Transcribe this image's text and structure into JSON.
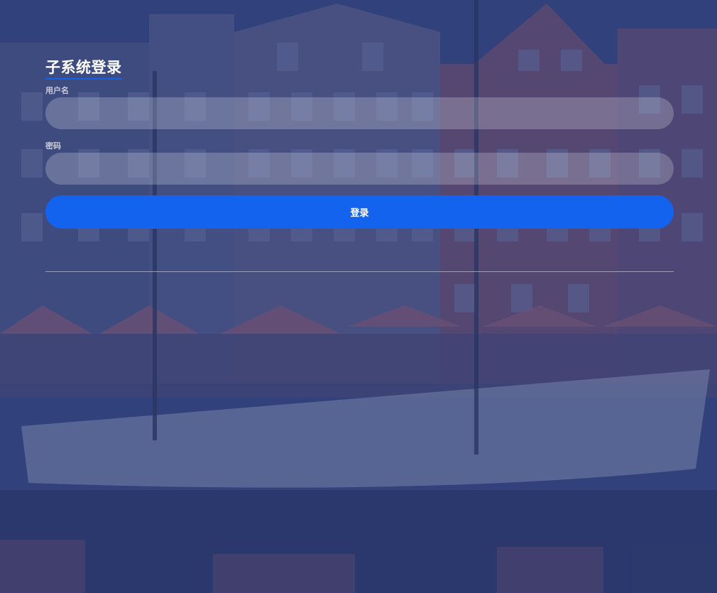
{
  "login": {
    "title": "子系统登录",
    "username_label": "用户名",
    "username_value": "",
    "password_label": "密码",
    "password_value": "",
    "submit_label": "登录"
  },
  "colors": {
    "accent": "#1463ef",
    "overlay": "#2d3c6e"
  }
}
